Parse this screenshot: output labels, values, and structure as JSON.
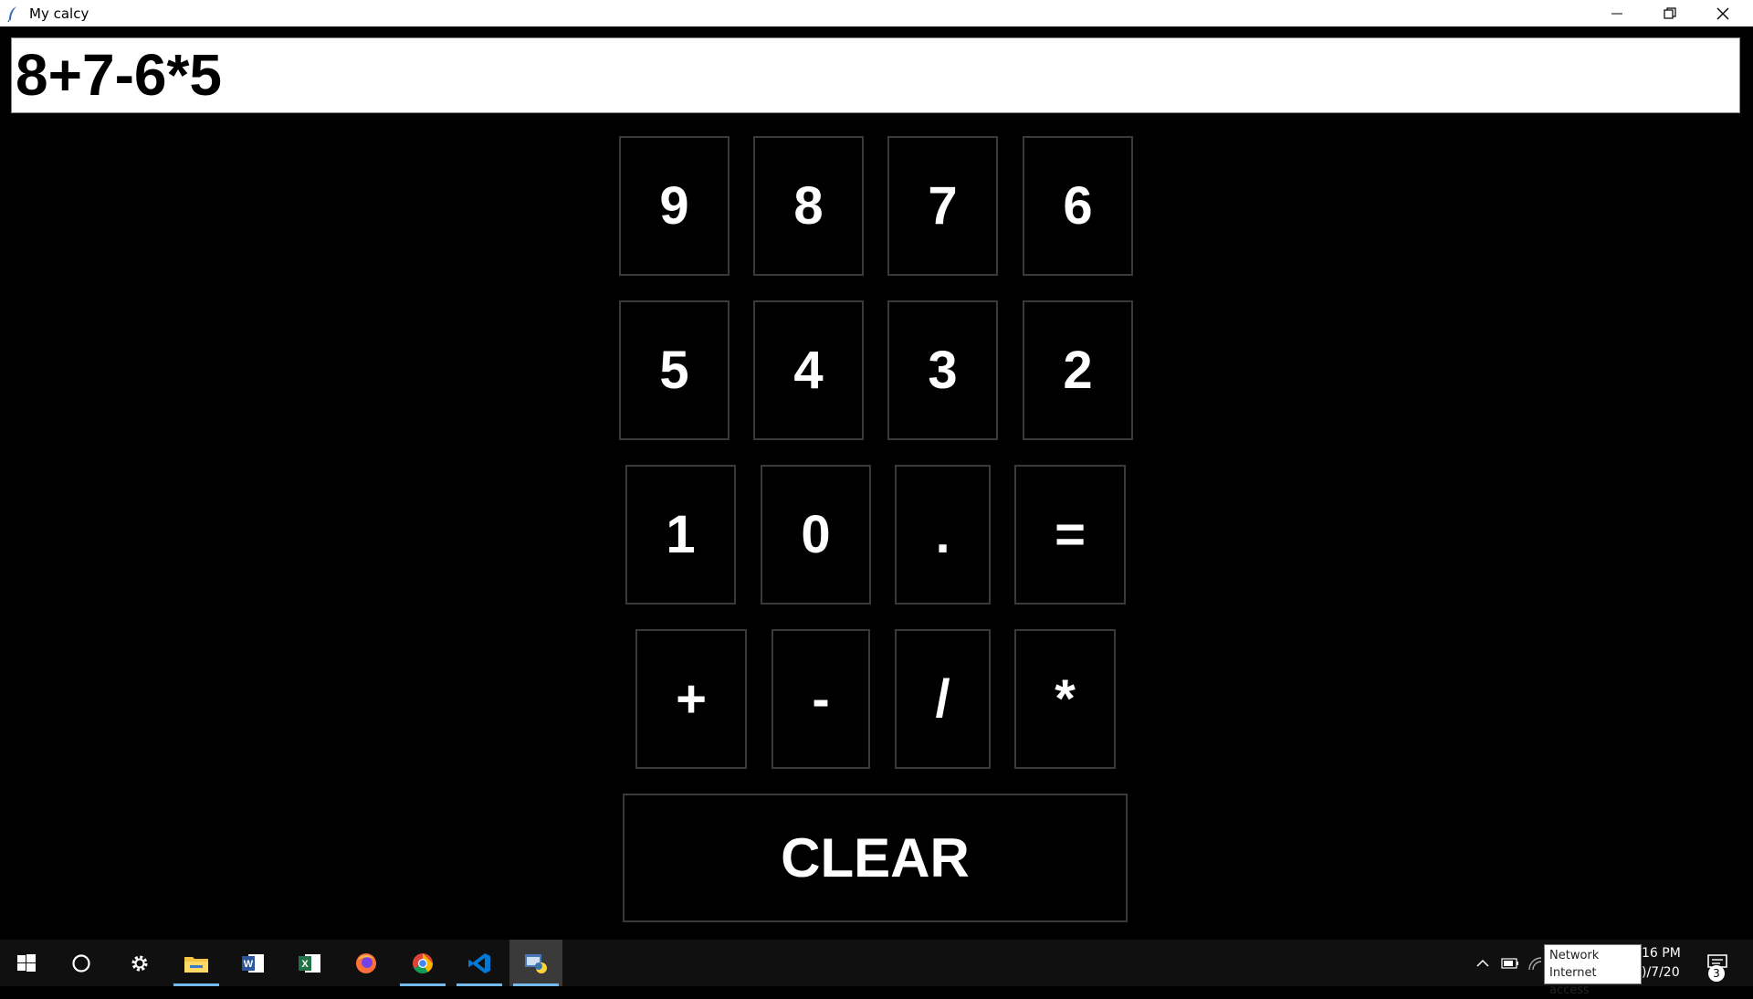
{
  "window": {
    "title": "My calcy",
    "controls": [
      "minimize-icon",
      "restore-icon",
      "close-icon"
    ]
  },
  "display": {
    "value": "8+7-6*5"
  },
  "keypad": {
    "row1": [
      "9",
      "8",
      "7",
      "6"
    ],
    "row2": [
      "5",
      "4",
      "3",
      "2"
    ],
    "row3": [
      "1",
      "0",
      ".",
      "="
    ],
    "row4": [
      "+",
      "-",
      "/",
      "*"
    ],
    "clear": "CLEAR"
  },
  "taskbar": {
    "apps": [
      "windows-start-icon",
      "cortana-search-icon",
      "settings-gear-icon",
      "file-explorer-icon",
      "word-icon",
      "excel-icon",
      "firefox-icon",
      "chrome-icon",
      "vscode-icon",
      "python-app-icon"
    ],
    "tray_tooltip": {
      "line1": "Network",
      "line2": "Internet access"
    },
    "clock": {
      "time": "16 PM",
      "date": ")/7/20"
    },
    "notification_count": "3"
  },
  "colors": {
    "background": "#000000",
    "key_border": "#3a3a3a",
    "taskbar": "#101010",
    "accent": "#76b9ed"
  }
}
